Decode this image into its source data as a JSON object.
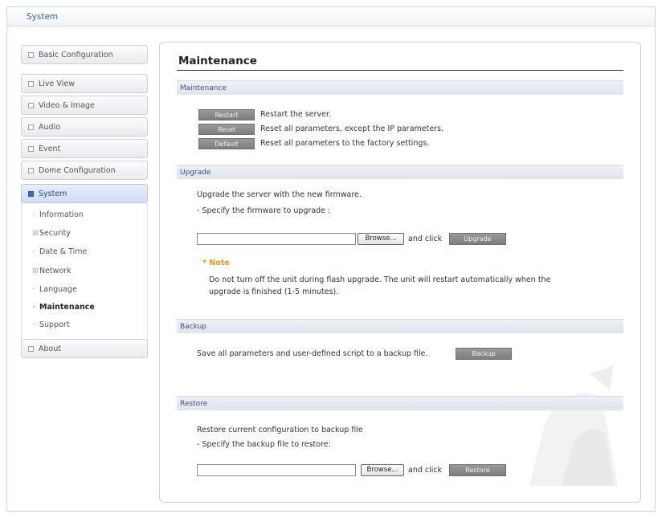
{
  "window": {
    "title": "System"
  },
  "sidebar": {
    "items": [
      {
        "label": "Basic Configuration"
      },
      {
        "label": "Live View"
      },
      {
        "label": "Video & Image"
      },
      {
        "label": "Audio"
      },
      {
        "label": "Event"
      },
      {
        "label": "Dome Configuration"
      },
      {
        "label": "System"
      },
      {
        "label": "About"
      }
    ],
    "system_children": [
      {
        "label": "Information"
      },
      {
        "label": "Security"
      },
      {
        "label": "Date & Time"
      },
      {
        "label": "Network"
      },
      {
        "label": "Language"
      },
      {
        "label": "Maintenance"
      },
      {
        "label": "Support"
      }
    ]
  },
  "page": {
    "title": "Maintenance"
  },
  "maintenance": {
    "header": "Maintenance",
    "rows": [
      {
        "button": "Restart",
        "text": "Restart the server."
      },
      {
        "button": "Reset",
        "text": "Reset all parameters, except the IP parameters."
      },
      {
        "button": "Default",
        "text": "Reset all parameters to the factory settings."
      }
    ]
  },
  "upgrade": {
    "header": "Upgrade",
    "line1": "Upgrade the server with the new firmware.",
    "line2": "- Specify the firmware to upgrade :",
    "browse": "Browse...",
    "and_click": "and click",
    "button": "Upgrade",
    "note_title": "* Note",
    "note_line1": "Do not turn off the unit during flash upgrade. The unit will restart automatically when the",
    "note_line2": "upgrade is finished (1-5 minutes)."
  },
  "backup": {
    "header": "Backup",
    "text": "Save all parameters and user-defined script to a backup file.",
    "button": "Backup"
  },
  "restore": {
    "header": "Restore",
    "line1": "Restore current configuration to backup file",
    "line2": "- Specify the backup file to restore:",
    "browse": "Browse...",
    "and_click": "and click",
    "button": "Restore"
  }
}
